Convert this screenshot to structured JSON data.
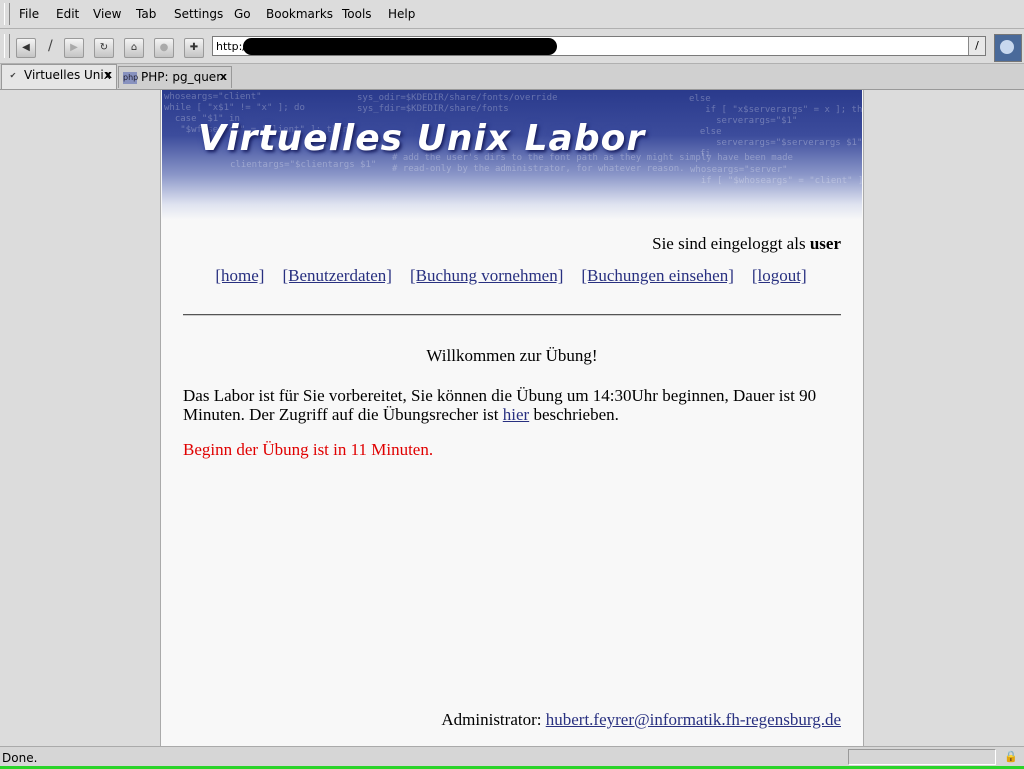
{
  "menu": [
    "File",
    "Edit",
    "View",
    "Tab",
    "Settings",
    "Go",
    "Bookmarks",
    "Tools",
    "Help"
  ],
  "menu_accel": [
    "F",
    "E",
    "V",
    "T",
    "S",
    "G",
    "B",
    "T",
    "H"
  ],
  "toolbar": {
    "url_value": "http:/",
    "icons": [
      "back-icon",
      "forward-icon",
      "reload-icon",
      "home-icon",
      "stop-icon",
      "new-tab-icon"
    ]
  },
  "tabs": [
    {
      "label": "Virtuelles Unix",
      "icon": "mozilla-favicon"
    },
    {
      "label": "PHP: pg_quer",
      "icon": "php-favicon",
      "icon_text": "php"
    }
  ],
  "banner": {
    "title": "Virtuelles Unix Labor",
    "code_lines": [
      "whoseargs=\"client\"\nwhile [ \"x$1\" != \"x\" ]; do\n  case \"$1\" in\n   \"$wfoseargs\" = \"client\" ]; then",
      "sys_odir=$KDEDIR/share/fonts/override\nsys_fdir=$KDEDIR/share/fonts",
      "else\n   if [ \"x$serverargs\" = x ]; then\n     serverargs=\"$1\"\n  else\n     serverargs=\"$serverargs $1\"\n  fi",
      "# add the user's dirs to the font path as they might simply have been made\n# read-only by the administrator, for whatever reason.",
      "whoseargs=\"server\"\n  if [ \"$whoseargs\" = \"client\" ]; then",
      "clientargs=\"$clientargs $1\""
    ]
  },
  "login": {
    "text": "Sie sind eingeloggt als ",
    "user": "user"
  },
  "nav": [
    "[home]",
    "[Benutzerdaten]",
    "[Buchung vornehmen]",
    "[Buchungen einsehen]",
    "[logout]"
  ],
  "welcome": "Willkommen zur  Übung!",
  "paragraph": {
    "before": "Das Labor ist für Sie vorbereitet, Sie können die Übung um 14:30Uhr beginnen, Dauer ist 90 Minuten. Der Zugriff auf die Übungsrecher ist ",
    "link": "hier",
    "after": " beschrieben."
  },
  "countdown": "Beginn der Übung ist in 11 Minuten.",
  "admin": {
    "label": "Administrator: ",
    "email": "hubert.feyrer@informatik.fh-regensburg.de"
  },
  "status": {
    "text": "Done."
  },
  "colors": {
    "link": "#283080",
    "countdown": "#e00000",
    "progress": "#2ad42a",
    "banner": "#2a3a8c"
  }
}
